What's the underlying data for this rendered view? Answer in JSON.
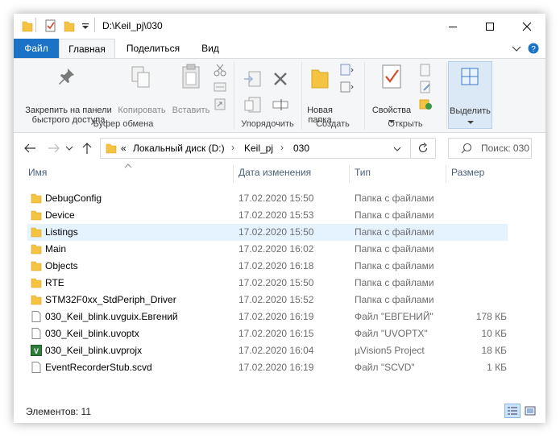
{
  "window": {
    "path": "D:\\Keil_pj\\030"
  },
  "tabs": {
    "file": "Файл",
    "home": "Главная",
    "share": "Поделиться",
    "view": "Вид"
  },
  "ribbon": {
    "pin": "Закрепить на панели быстрого доступа",
    "copy": "Копировать",
    "paste": "Вставить",
    "new_folder": "Новая папка",
    "properties": "Свойства",
    "select": "Выделить",
    "groups": {
      "clipboard": "Буфер обмена",
      "organize": "Упорядочить",
      "create": "Создать",
      "open": "Открыть"
    }
  },
  "address": {
    "overflow": "«",
    "crumbs": [
      "Локальный диск (D:)",
      "Keil_pj",
      "030"
    ],
    "search_placeholder": "Поиск: 030"
  },
  "columns": {
    "name": "Имя",
    "date": "Дата изменения",
    "type": "Тип",
    "size": "Размер"
  },
  "files": [
    {
      "name": "DebugConfig",
      "date": "17.02.2020 15:50",
      "type": "Папка с файлами",
      "size": "",
      "icon": "folder-icon"
    },
    {
      "name": "Device",
      "date": "17.02.2020 15:53",
      "type": "Папка с файлами",
      "size": "",
      "icon": "folder-icon"
    },
    {
      "name": "Listings",
      "date": "17.02.2020 15:50",
      "type": "Папка с файлами",
      "size": "",
      "icon": "folder-icon"
    },
    {
      "name": "Main",
      "date": "17.02.2020 16:02",
      "type": "Папка с файлами",
      "size": "",
      "icon": "folder-icon"
    },
    {
      "name": "Objects",
      "date": "17.02.2020 16:18",
      "type": "Папка с файлами",
      "size": "",
      "icon": "folder-icon"
    },
    {
      "name": "RTE",
      "date": "17.02.2020 15:50",
      "type": "Папка с файлами",
      "size": "",
      "icon": "folder-icon"
    },
    {
      "name": "STM32F0xx_StdPeriph_Driver",
      "date": "17.02.2020 15:52",
      "type": "Папка с файлами",
      "size": "",
      "icon": "folder-icon"
    },
    {
      "name": "030_Keil_blink.uvguix.Евгений",
      "date": "17.02.2020 16:19",
      "type": "Файл \"ЕВГЕНИЙ\"",
      "size": "178 КБ",
      "icon": "file-icon"
    },
    {
      "name": "030_Keil_blink.uvoptx",
      "date": "17.02.2020 16:15",
      "type": "Файл \"UVOPTX\"",
      "size": "10 КБ",
      "icon": "file-icon"
    },
    {
      "name": "030_Keil_blink.uvprojx",
      "date": "17.02.2020 16:04",
      "type": "µVision5 Project",
      "size": "18 КБ",
      "icon": "uvision-icon"
    },
    {
      "name": "EventRecorderStub.scvd",
      "date": "17.02.2020 16:19",
      "type": "Файл \"SCVD\"",
      "size": "1 КБ",
      "icon": "file-icon"
    }
  ],
  "status": {
    "count": "Элементов: 11"
  },
  "colors": {
    "accent": "#1a73c7",
    "folder": "#f5c342",
    "selection": "#e5f3ff"
  }
}
